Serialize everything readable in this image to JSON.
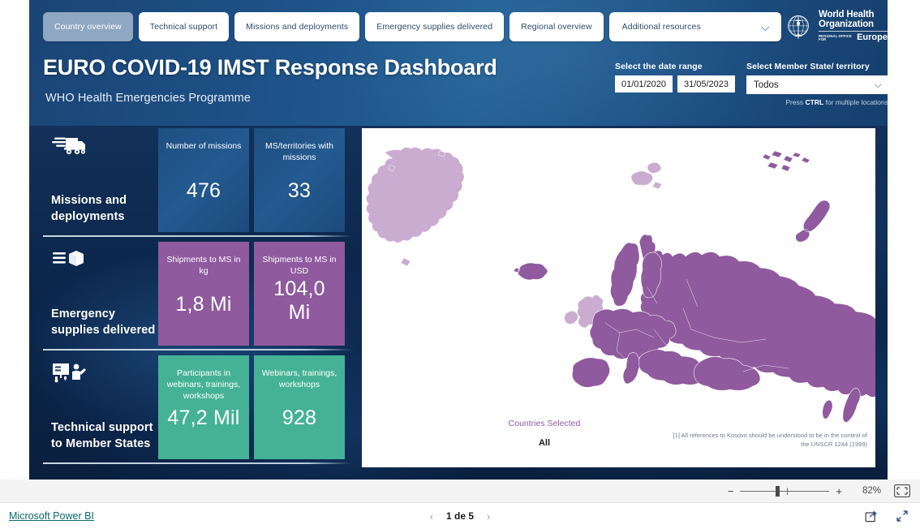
{
  "tabs": [
    {
      "label": "Country overview",
      "selected": true
    },
    {
      "label": "Technical support",
      "selected": false
    },
    {
      "label": "Missions and deployments",
      "selected": false
    },
    {
      "label": "Emergency supplies delivered",
      "selected": false
    },
    {
      "label": "Regional overview",
      "selected": false
    },
    {
      "label": "Additional resources",
      "selected": false,
      "dropdown": true
    }
  ],
  "header": {
    "title": "EURO COVID-19 IMST Response Dashboard",
    "subtitle": "WHO Health Emergencies Programme"
  },
  "logo": {
    "line1": "World Health",
    "line2": "Organization",
    "regional_office": "REGIONAL OFFICE FOR",
    "region": "Europe",
    "emblem_name": "who-emblem-icon"
  },
  "date_slicer": {
    "label": "Select the date range",
    "start": "01/01/2020",
    "end": "31/05/2023"
  },
  "ms_slicer": {
    "label": "Select Member State/ territory",
    "value": "Todos",
    "hint_pre": "Press ",
    "hint_bold": "CTRL",
    "hint_post": " for multiple locations",
    "chevron": "chevron-down-icon"
  },
  "kpi_sections": [
    {
      "icon": "truck-icon",
      "title": "Missions and deployments",
      "color": "blue",
      "cards": [
        {
          "label": "Number of missions",
          "value": "476"
        },
        {
          "label": "MS/territories with missions",
          "value": "33"
        }
      ]
    },
    {
      "icon": "supplies-box-icon",
      "title": "Emergency supplies delivered",
      "color": "purple",
      "cards": [
        {
          "label": "Shipments to MS in kg",
          "value": "1,8 Mi"
        },
        {
          "label": "Shipments to MS in USD",
          "value": "104,0 Mi"
        }
      ]
    },
    {
      "icon": "training-presentation-icon",
      "title": "Technical support to Member States",
      "color": "green",
      "cards": [
        {
          "label": "Participants in webinars, trainings, workshops",
          "value": "47,2 Mil"
        },
        {
          "label": "Webinars, trainings, workshops",
          "value": "928"
        }
      ]
    }
  ],
  "map": {
    "countries_selected_label": "Countries Selected",
    "countries_selected_value": "All",
    "footnote": "[1] All references to Kosovo should be understood to be in the context of the UNSCR 1244 (1999)",
    "fill_selected": "#8f5a9e",
    "fill_unselected": "#cbacd1"
  },
  "zoombar": {
    "minus": "−",
    "plus": "+",
    "percent": "82%",
    "fit_icon": "fit-to-page-icon"
  },
  "statusbar": {
    "brand": "Microsoft Power BI",
    "prev": "‹",
    "page": "1 de 5",
    "next": "›",
    "share_icon": "share-icon",
    "fullscreen_icon": "fullscreen-icon"
  }
}
